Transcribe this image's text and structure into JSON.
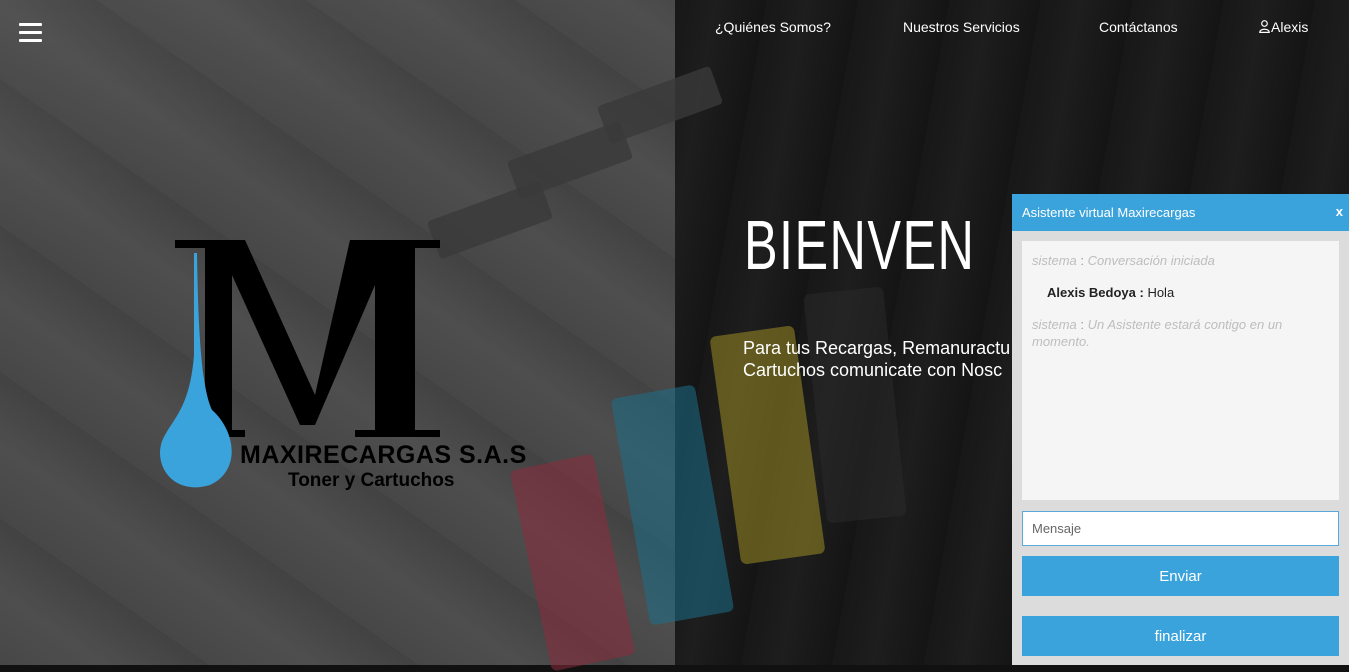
{
  "nav": {
    "quienes": "¿Quiénes Somos?",
    "servicios": "Nuestros Servicios",
    "contacto": "Contáctanos",
    "user": "Alexis"
  },
  "brand": {
    "name": "MAXIRECARGAS S.A.S",
    "tagline": "Toner y Cartuchos",
    "accent_color": "#3ba3dc"
  },
  "hero": {
    "title": "BIENVEN",
    "line1": "Para tus Recargas, Remanuractu",
    "line2": "Cartuchos comunicate con Nosc"
  },
  "chat": {
    "title": "Asistente virtual Maxirecargas",
    "close": "x",
    "messages": [
      {
        "sender": "sistema",
        "sep": " : ",
        "text": "Conversación iniciada"
      },
      {
        "sender": "Alexis Bedoya",
        "sep": " : ",
        "text": "Hola"
      },
      {
        "sender": "sistema",
        "sep": " : ",
        "text": "Un Asistente estará contigo en un momento."
      }
    ],
    "input_placeholder": "Mensaje",
    "send_label": "Enviar",
    "finish_label": "finalizar"
  }
}
